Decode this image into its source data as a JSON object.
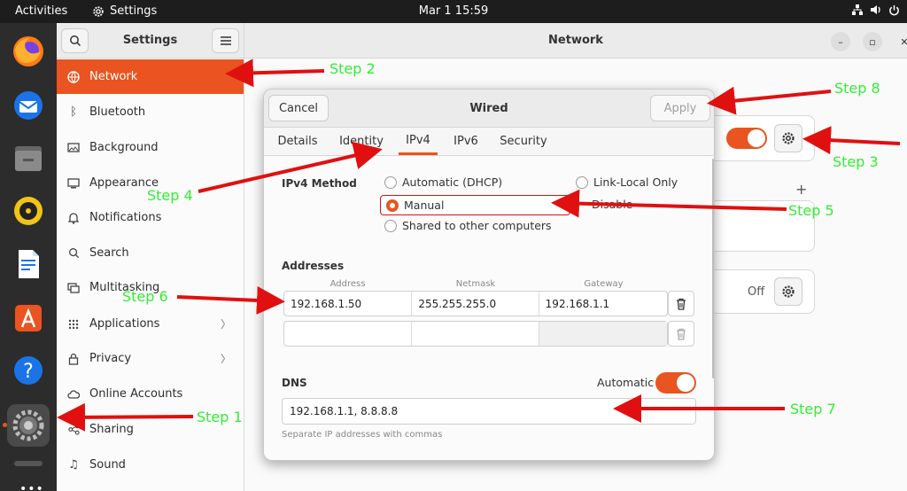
{
  "topbar": {
    "activities": "Activities",
    "app_name": "Settings",
    "clock": "Mar 1  15:59"
  },
  "sidebar": {
    "title": "Settings",
    "items": [
      {
        "label": "Network",
        "icon": "network-icon"
      },
      {
        "label": "Bluetooth",
        "icon": "bluetooth-icon"
      },
      {
        "label": "Background",
        "icon": "background-icon"
      },
      {
        "label": "Appearance",
        "icon": "appearance-icon"
      },
      {
        "label": "Notifications",
        "icon": "bell-icon"
      },
      {
        "label": "Search",
        "icon": "search-icon"
      },
      {
        "label": "Multitasking",
        "icon": "multitasking-icon"
      },
      {
        "label": "Applications",
        "icon": "grid-icon"
      },
      {
        "label": "Privacy",
        "icon": "lock-icon"
      },
      {
        "label": "Online Accounts",
        "icon": "cloud-icon"
      },
      {
        "label": "Sharing",
        "icon": "share-icon"
      },
      {
        "label": "Sound",
        "icon": "music-note-icon"
      }
    ]
  },
  "main": {
    "title": "Network",
    "vpn_status": "Off"
  },
  "dialog": {
    "title": "Wired",
    "cancel_label": "Cancel",
    "apply_label": "Apply",
    "tabs": [
      "Details",
      "Identity",
      "IPv4",
      "IPv6",
      "Security"
    ],
    "active_tab": "IPv4",
    "ipv4_method_label": "IPv4 Method",
    "methods": {
      "automatic": "Automatic (DHCP)",
      "link_local": "Link-Local Only",
      "manual": "Manual",
      "disable": "Disable",
      "shared": "Shared to other computers"
    },
    "selected_method": "Manual",
    "addresses_label": "Addresses",
    "columns": {
      "address": "Address",
      "netmask": "Netmask",
      "gateway": "Gateway"
    },
    "address_row": {
      "address": "192.168.1.50",
      "netmask": "255.255.255.0",
      "gateway": "192.168.1.1"
    },
    "dns_label": "DNS",
    "dns_automatic_label": "Automatic",
    "dns_value": "192.168.1.1, 8.8.8.8",
    "dns_hint": "Separate IP addresses with commas"
  },
  "annotations": {
    "step1": "Step 1",
    "step2": "Step 2",
    "step3": "Step 3",
    "step4": "Step 4",
    "step5": "Step 5",
    "step6": "Step 6",
    "step7": "Step 7",
    "step8": "Step 8"
  },
  "colors": {
    "accent": "#e95420",
    "annotation_arrow": "#e01010",
    "annotation_text": "#33ee33"
  }
}
